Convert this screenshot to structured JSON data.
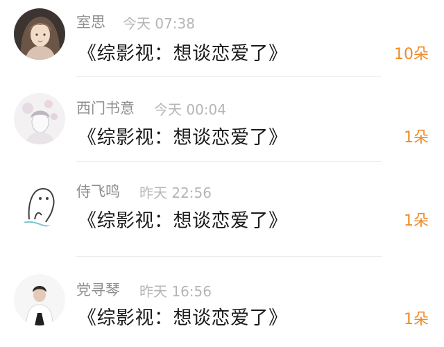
{
  "list": {
    "items": [
      {
        "name": "室思",
        "time": "今天 07:38",
        "title": "《综影视：想谈恋爱了》",
        "count": "10朵"
      },
      {
        "name": "西门书意",
        "time": "今天 00:04",
        "title": "《综影视：想谈恋爱了》",
        "count": "1朵"
      },
      {
        "name": "侍飞鸣",
        "time": "昨天 22:56",
        "title": "《综影视：想谈恋爱了》",
        "count": "1朵"
      },
      {
        "name": "党寻琴",
        "time": "昨天 16:56",
        "title": "《综影视：想谈恋爱了》",
        "count": "1朵"
      }
    ]
  },
  "colors": {
    "name": "#8e8e8e",
    "time": "#b5b5b5",
    "title": "#1a1a1a",
    "count_accent": "#f08a24",
    "divider": "#ececec"
  },
  "icons": {
    "avatar_1": "avatar-girl-portrait",
    "avatar_2": "avatar-floral-sketch",
    "avatar_3": "avatar-ghost-sketch",
    "avatar_4": "avatar-person-white-shirt"
  }
}
